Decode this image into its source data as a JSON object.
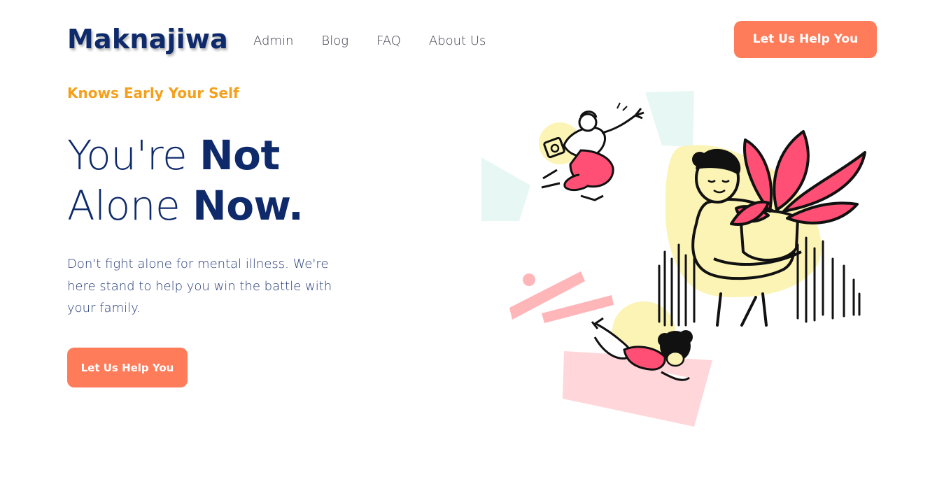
{
  "header": {
    "logo": "Maknajiwa",
    "nav": [
      "Admin",
      "Blog",
      "FAQ",
      "About Us"
    ],
    "cta_label": "Let Us Help You"
  },
  "hero": {
    "eyebrow": "Knows Early Your Self",
    "headline": {
      "line1_light": "You're ",
      "line1_bold": "Not",
      "line2_light": "Alone ",
      "line2_bold": "Now."
    },
    "description": "Don't fight alone for mental illness. We're here stand to help you win the battle with your family.",
    "cta_label": "Let Us Help You"
  },
  "colors": {
    "navy": "#0f2a6b",
    "orange_accent": "#f5a01b",
    "button": "#ff7c5a",
    "pink": "#ff4f74",
    "pale_yellow": "#fbf4b5",
    "mint": "#e7f7f3",
    "light_pink": "#ffd6d9"
  },
  "illustration": {
    "icon": "people-with-plant-illustration"
  }
}
